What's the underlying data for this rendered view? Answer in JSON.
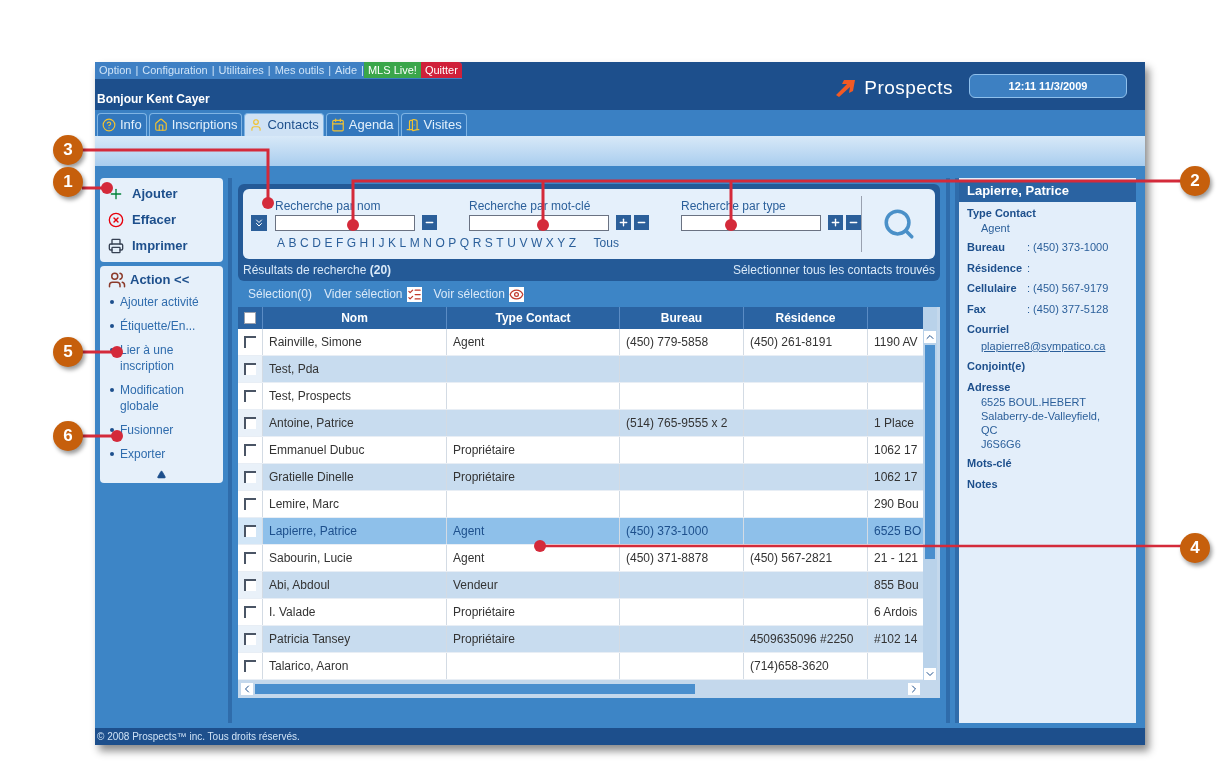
{
  "top_menu": [
    {
      "label": "Option",
      "kind": "link"
    },
    {
      "label": "|",
      "kind": "separator"
    },
    {
      "label": "Configuration",
      "kind": "link"
    },
    {
      "label": "|",
      "kind": "separator"
    },
    {
      "label": "Utilitaires",
      "kind": "link"
    },
    {
      "label": "|",
      "kind": "separator"
    },
    {
      "label": "Mes outils",
      "kind": "link"
    },
    {
      "label": "|",
      "kind": "separator"
    },
    {
      "label": "Aide",
      "kind": "link"
    },
    {
      "label": "|",
      "kind": "separator"
    },
    {
      "label": "MLS Live!",
      "kind": "green"
    },
    {
      "label": "Quitter",
      "kind": "red"
    }
  ],
  "greeting": "Bonjour Kent Cayer",
  "logo": "Prospects",
  "clock": "12:11 11/3/2009",
  "tabs": [
    {
      "label": "Info",
      "selected": false
    },
    {
      "label": "Inscriptions",
      "selected": false
    },
    {
      "label": "Contacts",
      "selected": true
    },
    {
      "label": "Agenda",
      "selected": false
    },
    {
      "label": "Visites",
      "selected": false
    }
  ],
  "sidebar": {
    "buttons": [
      "Ajouter",
      "Effacer",
      "Imprimer"
    ],
    "action_title": "Action <<",
    "actions": [
      "Ajouter activité",
      "Étiquette/En...",
      "Lier à une inscription",
      "Modification globale",
      "Fusionner",
      "Exporter"
    ]
  },
  "search": {
    "fields": [
      {
        "label": "Recherche par nom",
        "plus": false
      },
      {
        "label": "Recherche par mot-clé",
        "plus": true
      },
      {
        "label": "Recherche par type",
        "plus": true
      }
    ],
    "letters": [
      "A",
      "B",
      "C",
      "D",
      "E",
      "F",
      "G",
      "H",
      "I",
      "J",
      "K",
      "L",
      "M",
      "N",
      "O",
      "P",
      "Q",
      "R",
      "S",
      "T",
      "U",
      "V",
      "W",
      "X",
      "Y",
      "Z"
    ],
    "all": "Tous",
    "results_label": "Résultats de recherche **(20)**",
    "select_all": "Sélectionner tous les contacts trouvés"
  },
  "selection": {
    "count": "Sélection(0)",
    "clear": "Vider sélection",
    "view": "Voir sélection"
  },
  "table": {
    "header_checked": false,
    "columns": [
      "Nom",
      "Type Contact",
      "Bureau",
      "Résidence"
    ],
    "rows": [
      {
        "name": "Rainville, Simone",
        "type": "Agent",
        "bureau": "(450) 779-5858",
        "residence": "(450) 261-8191",
        "column_5": "1190 AV",
        "checked": false,
        "selected": false
      },
      {
        "name": "Test, Pda",
        "type": "",
        "bureau": "",
        "residence": "",
        "column_5": "",
        "checked": false,
        "selected": false
      },
      {
        "name": "Test, Prospects",
        "type": "",
        "bureau": "",
        "residence": "",
        "column_5": "",
        "checked": false,
        "selected": false
      },
      {
        "name": "Antoine, Patrice",
        "type": "",
        "bureau": "(514) 765-9555 x 2",
        "residence": "",
        "column_5": "1 Place",
        "checked": false,
        "selected": false
      },
      {
        "name": "Emmanuel Dubuc",
        "type": "Propriétaire",
        "bureau": "",
        "residence": "",
        "column_5": "1062 17",
        "checked": false,
        "selected": false
      },
      {
        "name": "Gratielle Dinelle",
        "type": "Propriétaire",
        "bureau": "",
        "residence": "",
        "column_5": "1062 17",
        "checked": false,
        "selected": false
      },
      {
        "name": "Lemire, Marc",
        "type": "",
        "bureau": "",
        "residence": "",
        "column_5": "290 Bou",
        "checked": false,
        "selected": false
      },
      {
        "name": "Lapierre, Patrice",
        "type": "Agent",
        "bureau": "(450) 373-1000",
        "residence": "",
        "column_5": "6525 BO",
        "checked": false,
        "selected": true
      },
      {
        "name": "Sabourin, Lucie",
        "type": "Agent",
        "bureau": "(450) 371-8878",
        "residence": "(450) 567-2821",
        "column_5": "21 - 121",
        "checked": false,
        "selected": false
      },
      {
        "name": "Abi, Abdoul",
        "type": "Vendeur",
        "bureau": "",
        "residence": "",
        "column_5": "855 Bou",
        "checked": false,
        "selected": false
      },
      {
        "name": "I. Valade",
        "type": "Propriétaire",
        "bureau": "",
        "residence": "",
        "column_5": "6 Ardois",
        "checked": false,
        "selected": false
      },
      {
        "name": "Patricia Tansey",
        "type": "Propriétaire",
        "bureau": "",
        "residence": "4509635096 #2250",
        "column_5": "#102 14",
        "checked": false,
        "selected": false
      },
      {
        "name": "Talarico, Aaron",
        "type": "",
        "bureau": "",
        "residence": "(714)658-3620",
        "column_5": "",
        "checked": false,
        "selected": false
      }
    ]
  },
  "detail": {
    "title": "Lapierre, Patrice",
    "fields": [
      {
        "label": "Type Contact",
        "kind": "below",
        "lines": [
          "Agent"
        ]
      },
      {
        "label": "Bureau",
        "kind": "inline",
        "value": ": (450) 373-1000"
      },
      {
        "label": "Résidence",
        "kind": "inline",
        "value": ":"
      },
      {
        "label": "Cellulaire",
        "kind": "inline",
        "value": ": (450) 567-9179"
      },
      {
        "label": "Fax",
        "kind": "inline",
        "value": ": (450) 377-5128"
      },
      {
        "label": "Courriel",
        "kind": "link",
        "lines": [
          "plapierre8@sympatico.ca"
        ]
      },
      {
        "label": "Conjoint(e)",
        "kind": "label"
      },
      {
        "label": "Adresse",
        "kind": "below",
        "lines": [
          "6525 BOUL.HEBERT",
          "Salaberry-de-Valleyfield,",
          "QC",
          "J6S6G6"
        ]
      },
      {
        "label": "Mots-clé",
        "kind": "label"
      },
      {
        "label": "Notes",
        "kind": "label"
      }
    ]
  },
  "footer": "© 2008 Prospects™ inc. Tous droits réservés.",
  "callouts": [
    "3",
    "1",
    "2",
    "5",
    "6",
    "4"
  ]
}
